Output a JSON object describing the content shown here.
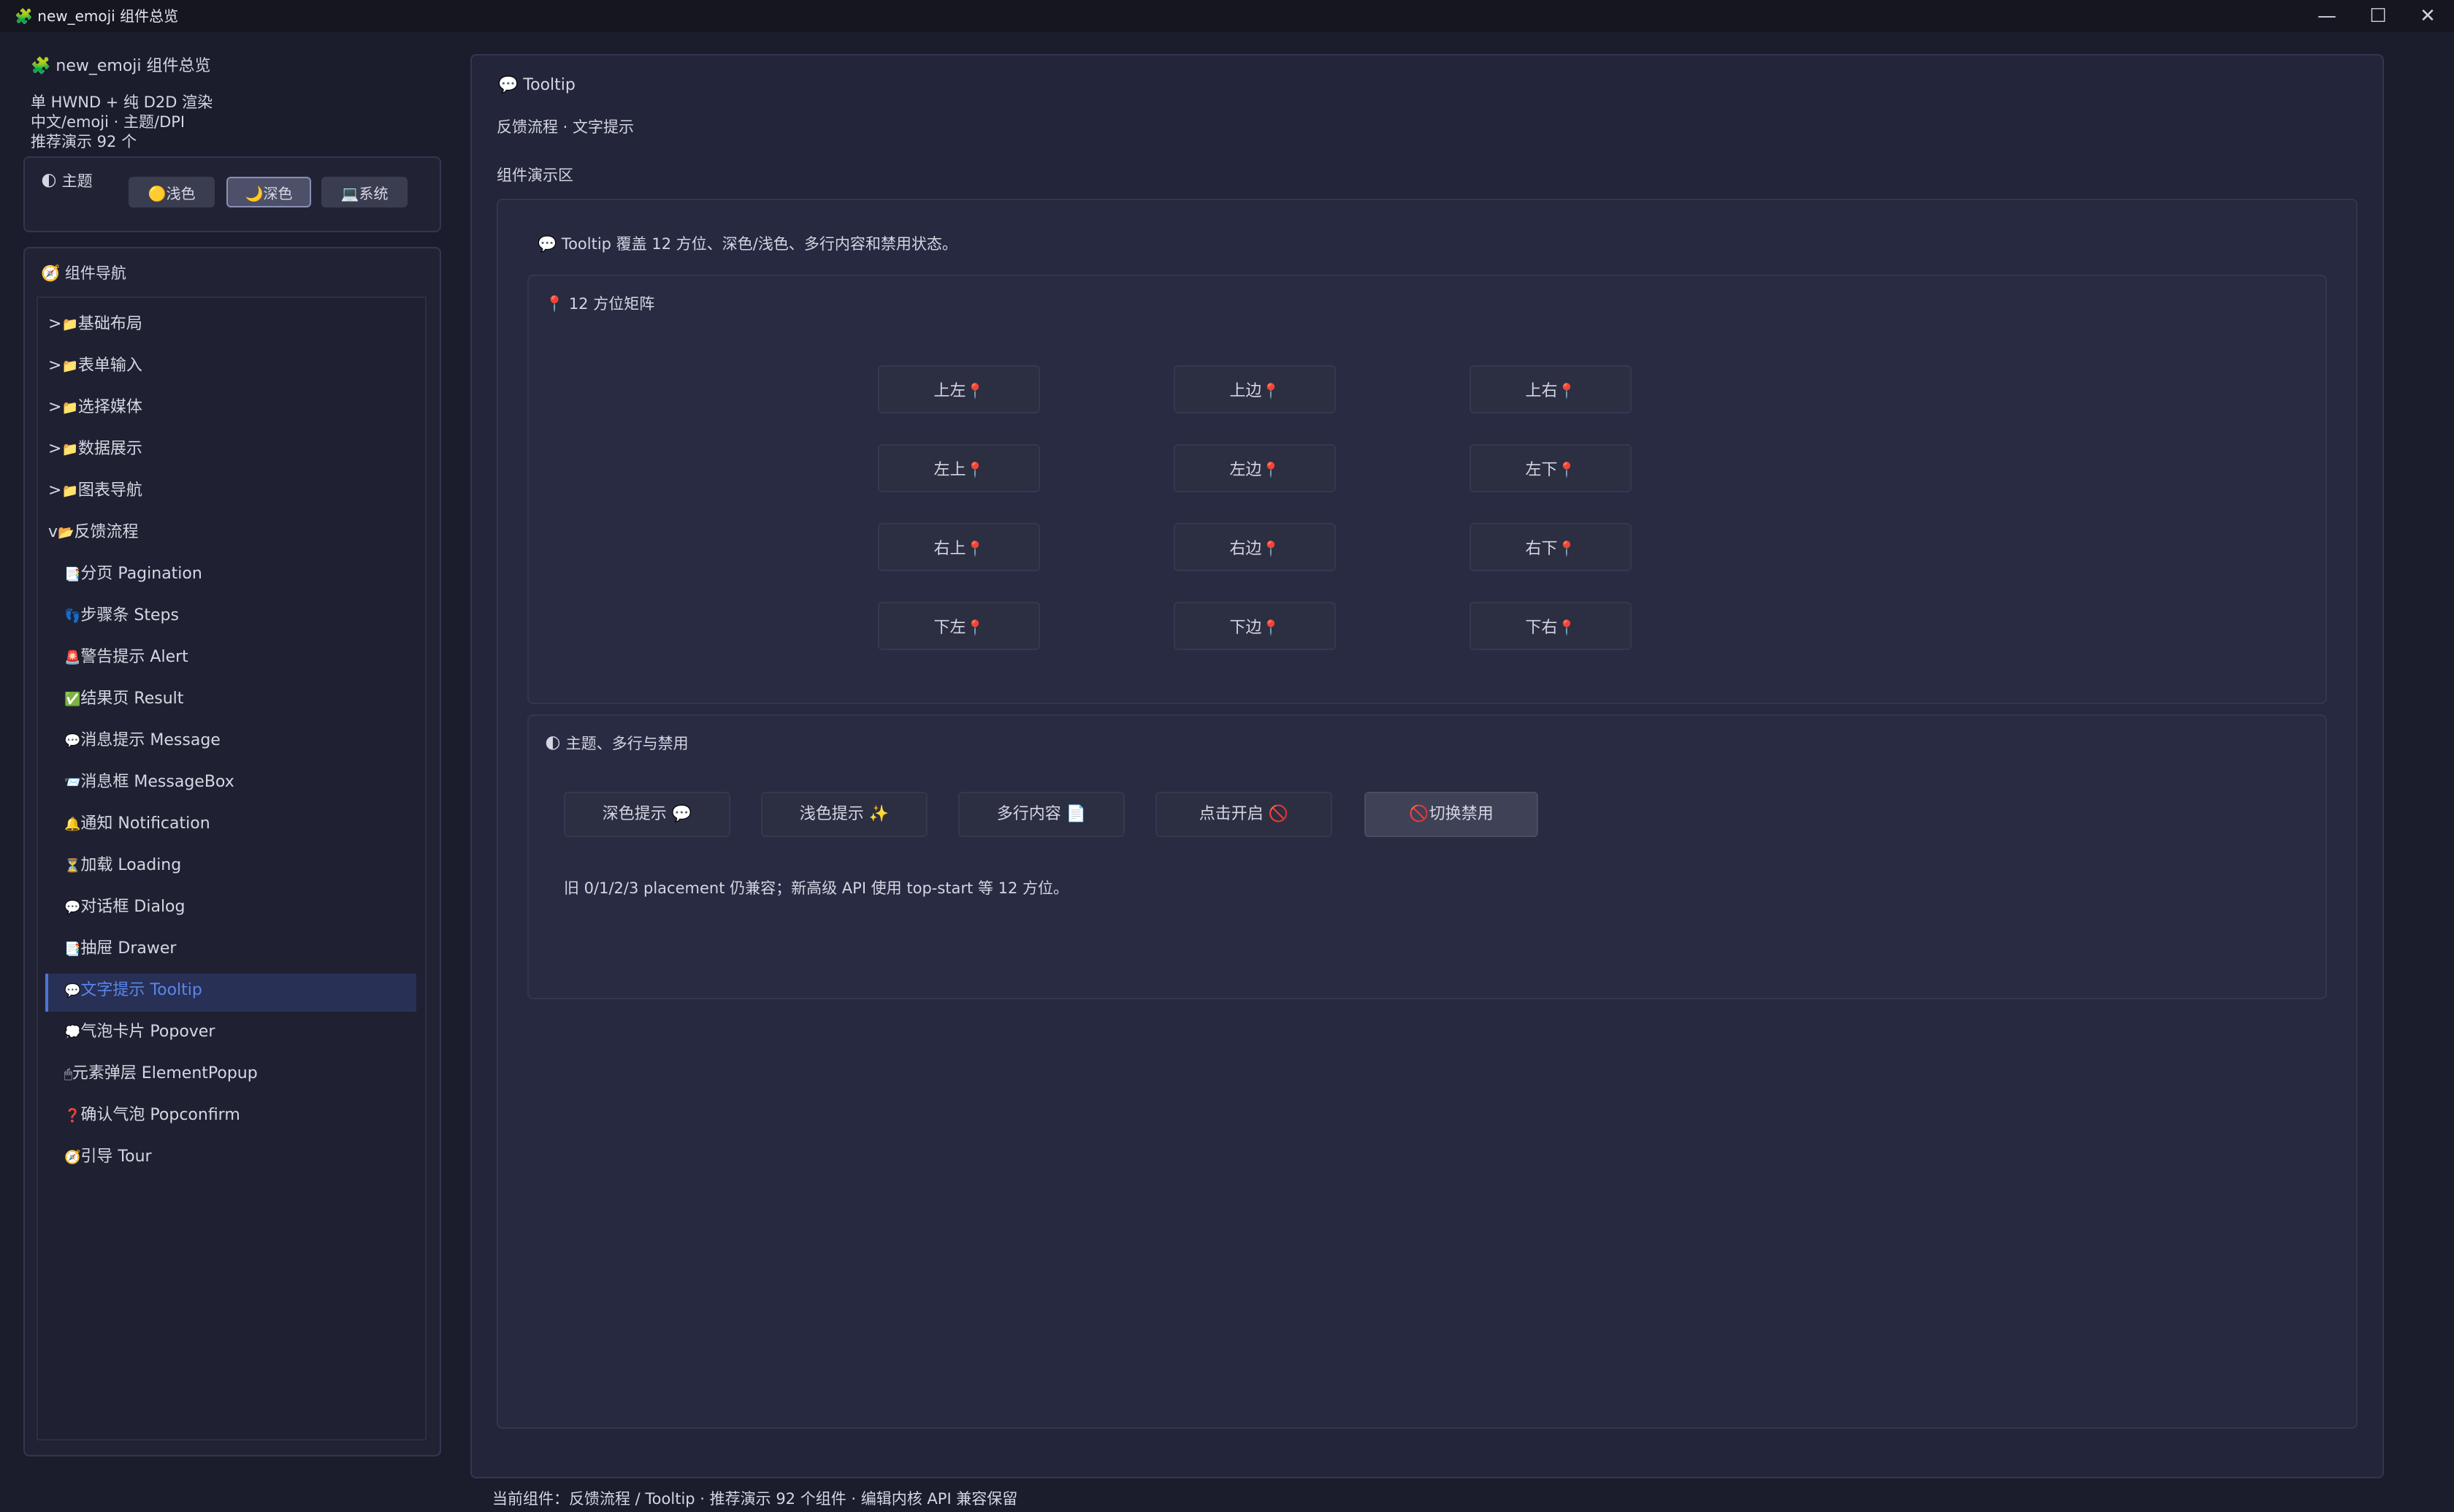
{
  "window": {
    "title": "new_emoji 组件总览",
    "app_icon": "🧩",
    "controls": {
      "minimize": "—",
      "maximize": "☐",
      "close": "✕"
    }
  },
  "sidebar": {
    "app_title": "new_emoji 组件总览",
    "info_lines": [
      "单 HWND + 纯 D2D 渲染",
      "中文/emoji · 主题/DPI",
      "推荐演示 92 个"
    ],
    "theme": {
      "title": "主题",
      "options": [
        {
          "icon": "🟡",
          "label": "浅色"
        },
        {
          "icon": "🌙",
          "label": "深色"
        },
        {
          "icon": "💻",
          "label": "系统"
        }
      ],
      "selected": "深色"
    },
    "nav": {
      "title": "组件导航",
      "groups": [
        {
          "prefix": ">",
          "icon": "📁",
          "label": "基础布局"
        },
        {
          "prefix": ">",
          "icon": "📁",
          "label": "表单输入"
        },
        {
          "prefix": ">",
          "icon": "📁",
          "label": "选择媒体"
        },
        {
          "prefix": ">",
          "icon": "📁",
          "label": "数据展示"
        },
        {
          "prefix": ">",
          "icon": "📁",
          "label": "图表导航"
        },
        {
          "prefix": "v",
          "icon": "📂",
          "label": "反馈流程"
        }
      ],
      "items": [
        {
          "icon": "📑",
          "label": "分页 Pagination"
        },
        {
          "icon": "👣",
          "label": "步骤条 Steps"
        },
        {
          "icon": "🚨",
          "label": "警告提示 Alert"
        },
        {
          "icon": "✅",
          "label": "结果页 Result"
        },
        {
          "icon": "💬",
          "label": "消息提示 Message"
        },
        {
          "icon": "📨",
          "label": "消息框 MessageBox"
        },
        {
          "icon": "🔔",
          "label": "通知 Notification"
        },
        {
          "icon": "⏳",
          "label": "加载 Loading"
        },
        {
          "icon": "💬",
          "label": "对话框 Dialog"
        },
        {
          "icon": "📑",
          "label": "抽屉 Drawer"
        },
        {
          "icon": "💬",
          "label": "文字提示 Tooltip"
        },
        {
          "icon": "💭",
          "label": "气泡卡片 Popover"
        },
        {
          "icon": "🖱",
          "label": "元素弹层 ElementPopup"
        },
        {
          "icon": "❓",
          "label": "确认气泡 Popconfirm"
        },
        {
          "icon": "🧭",
          "label": "引导 Tour"
        }
      ],
      "selected": "文字提示 Tooltip"
    }
  },
  "main": {
    "title_icon": "💬",
    "title": "Tooltip",
    "subtitle": "反馈流程 · 文字提示",
    "demo_label": "组件演示区",
    "intro": "💬 Tooltip 覆盖 12 方位、深色/浅色、多行内容和禁用状态。",
    "matrix": {
      "title": "📍 12 方位矩阵",
      "rows": [
        [
          "上左",
          "上边",
          "上右"
        ],
        [
          "左上",
          "左边",
          "左下"
        ],
        [
          "右上",
          "右边",
          "右下"
        ],
        [
          "下左",
          "下边",
          "下右"
        ]
      ],
      "pin": "📍"
    },
    "theme_section": {
      "title": "🌓 主题、多行与禁用",
      "buttons": [
        {
          "label": "深色提示 💬"
        },
        {
          "label": "浅色提示 ✨"
        },
        {
          "label": "多行内容 📄"
        },
        {
          "label": "点击开启 🚫"
        },
        {
          "label": "🚫切换禁用"
        }
      ],
      "note": "旧 0/1/2/3 placement 仍兼容；新高级 API 使用 top-start 等 12 方位。"
    }
  },
  "status_bar": "当前组件：反馈流程 / Tooltip · 推荐演示 92 个组件 · 编辑内核 API 兼容保留",
  "colors": {
    "background": "#1b1c2c",
    "panel": "#212335",
    "titlebar": "#15161f",
    "accent": "#4f74d8",
    "selected_text": "#5a86e8",
    "pin": "#e04a3a"
  }
}
